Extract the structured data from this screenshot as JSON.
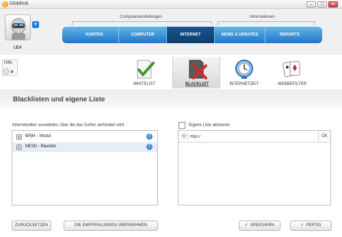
{
  "window": {
    "title": "GlobRob",
    "minimize": "–",
    "maximize": "□",
    "close": "✕"
  },
  "user": {
    "name": "LEA",
    "avatar_icon": "robot-avatar-icon",
    "dropdown_icon": "▼"
  },
  "nav": {
    "groups": [
      "Computereinstellungen",
      "Informationen"
    ],
    "tabs": [
      "KONTEN",
      "COMPUTER",
      "INTERNET",
      "NEWS & UPDATES",
      "REPORTS"
    ],
    "active_tab": "INTERNET"
  },
  "help": {
    "label": "Hilfe",
    "arrow": "»"
  },
  "tools": [
    {
      "label": "WHITELIST",
      "icon": "document-checkmark-icon"
    },
    {
      "label": "BLACKLIST",
      "icon": "document-cross-icon"
    },
    {
      "label": "INTERNETZEIT",
      "icon": "globe-clock-icon"
    },
    {
      "label": "WEBBEFILTER",
      "icon": "cards-filter-icon"
    }
  ],
  "active_tool": "BLACKLIST",
  "main": {
    "title": "Blacklisten und eigene Liste",
    "left_hint": "Internetseiten auswählen, über die das Surfen verhindert wird",
    "lists": [
      {
        "label": "BPjM – Modul",
        "info": "i"
      },
      {
        "label": "MESD - Blacklist",
        "info": "i"
      }
    ],
    "own_list_label": "Eigene Liste aktivieren",
    "url_value": "http://",
    "ok_label": "OK"
  },
  "buttons": {
    "reset": "ZURÜCKSETZEN",
    "recommend": "DIE EMPFEHLUNGEN ÜBERNEHMEN",
    "save": "SPEICHERN",
    "done": "FERTIG",
    "done_tick": "✓"
  },
  "colors": {
    "nav_blue": "#1e77c5",
    "nav_active": "#0e3f6e",
    "info_blue": "#3d8fd9",
    "check_green": "#3c9a2a",
    "cross_red": "#d22a2a"
  }
}
